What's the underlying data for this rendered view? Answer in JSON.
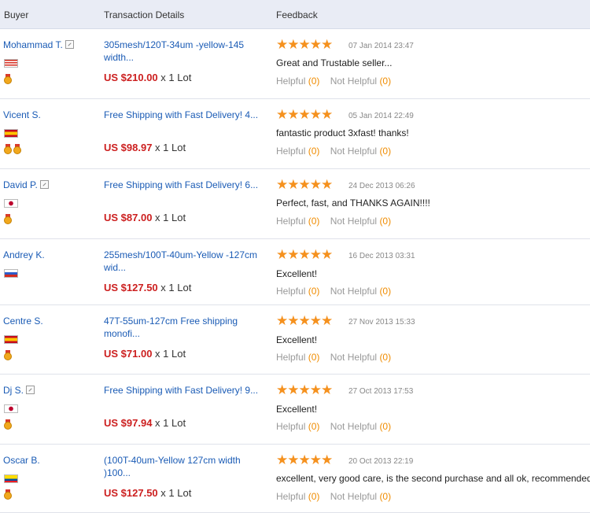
{
  "header": {
    "buyer": "Buyer",
    "transaction": "Transaction Details",
    "feedback": "Feedback"
  },
  "rows": [
    {
      "buyer": "Mohammad T.",
      "verified": true,
      "flag": "Malaysia",
      "medals": 1,
      "product": "305mesh/120T-34um -yellow-145 width...",
      "price": "US $210.00",
      "qty": " x 1 Lot",
      "stars": "★★★★★",
      "date": "07 Jan 2014 23:47",
      "feedback": "Great and Trustable seller...",
      "helpful_label": "Helpful",
      "helpful_count": "(0)",
      "not_helpful_label": "Not Helpful",
      "not_helpful_count": "(0)"
    },
    {
      "buyer": "Vicent S.",
      "verified": false,
      "flag": "Spain",
      "medals": 2,
      "product": "Free Shipping with Fast Delivery! 4...",
      "price": "US $98.97",
      "qty": " x 1 Lot",
      "stars": "★★★★★",
      "date": "05 Jan 2014 22:49",
      "feedback": "fantastic product 3xfast! thanks!",
      "helpful_label": "Helpful",
      "helpful_count": "(0)",
      "not_helpful_label": "Not Helpful",
      "not_helpful_count": "(0)"
    },
    {
      "buyer": "David P.",
      "verified": true,
      "flag": "Japan",
      "medals": 1,
      "product": "Free Shipping with Fast Delivery! 6...",
      "price": "US $87.00",
      "qty": " x 1 Lot",
      "stars": "★★★★★",
      "date": "24 Dec 2013 06:26",
      "feedback": "Perfect, fast, and THANKS AGAIN!!!!",
      "helpful_label": "Helpful",
      "helpful_count": "(0)",
      "not_helpful_label": "Not Helpful",
      "not_helpful_count": "(0)"
    },
    {
      "buyer": "Andrey K.",
      "verified": false,
      "flag": "Russia",
      "medals": 0,
      "product": "255mesh/100T-40um-Yellow -127cm wid...",
      "price": "US $127.50",
      "qty": " x 1 Lot",
      "stars": "★★★★★",
      "date": "16 Dec 2013 03:31",
      "feedback": "Excellent!",
      "helpful_label": "Helpful",
      "helpful_count": "(0)",
      "not_helpful_label": "Not Helpful",
      "not_helpful_count": "(0)"
    },
    {
      "buyer": "Centre S.",
      "verified": false,
      "flag": "Spain",
      "medals": 1,
      "product": "47T-55um-127cm Free shipping monofi...",
      "price": "US $71.00",
      "qty": " x 1 Lot",
      "stars": "★★★★★",
      "date": "27 Nov 2013 15:33",
      "feedback": "Excellent!",
      "helpful_label": "Helpful",
      "helpful_count": "(0)",
      "not_helpful_label": "Not Helpful",
      "not_helpful_count": "(0)"
    },
    {
      "buyer": "Dj S.",
      "verified": true,
      "flag": "Japan",
      "medals": 1,
      "product": "Free Shipping with Fast Delivery! 9...",
      "price": "US $97.94",
      "qty": " x 1 Lot",
      "stars": "★★★★★",
      "date": "27 Oct 2013 17:53",
      "feedback": "Excellent!",
      "helpful_label": "Helpful",
      "helpful_count": "(0)",
      "not_helpful_label": "Not Helpful",
      "not_helpful_count": "(0)"
    },
    {
      "buyer": "Oscar B.",
      "verified": false,
      "flag": "Ecuador",
      "medals": 1,
      "product": "(100T-40um-Yellow 127cm width )100...",
      "price": "US $127.50",
      "qty": " x 1 Lot",
      "stars": "★★★★★",
      "date": "20 Oct 2013 22:19",
      "feedback": "excellent, very good care, is the second purchase and all ok, recommended",
      "helpful_label": "Helpful",
      "helpful_count": "(0)",
      "not_helpful_label": "Not Helpful",
      "not_helpful_count": "(0)"
    }
  ],
  "colors": {
    "link": "#1a5bb5",
    "price": "#cc1f1f",
    "star": "#f5911e",
    "count": "#f08c00",
    "header_bg": "#e9ecf5"
  }
}
